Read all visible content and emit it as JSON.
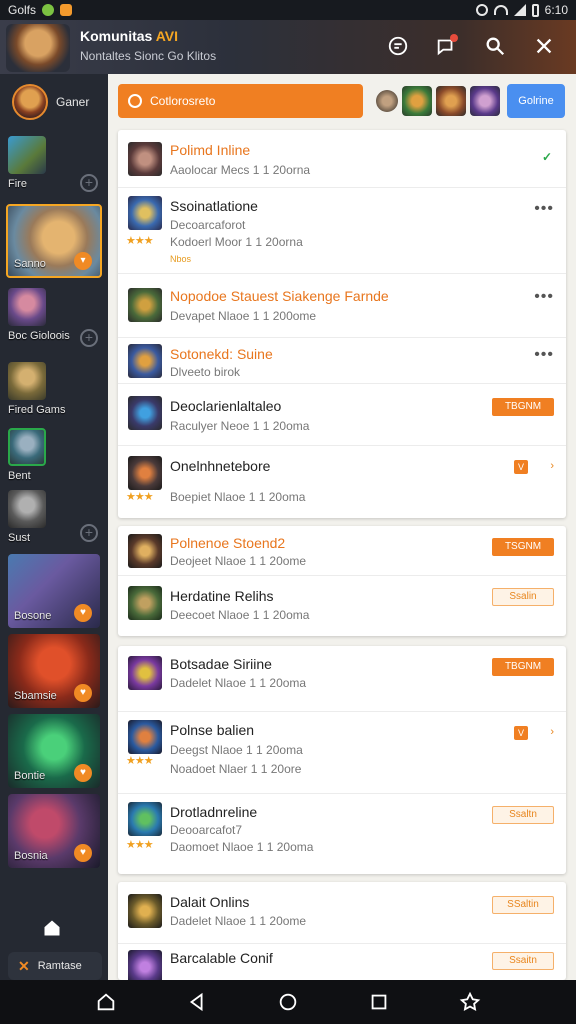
{
  "status": {
    "left_text": "Golfs",
    "time": "6:10"
  },
  "header": {
    "title": "Komunitas",
    "title_accent": "AVI",
    "subtitle": "Nontaltes Sionc Go Klitos"
  },
  "sidebar": {
    "profile_name": "Ganer",
    "items": [
      {
        "label": "Fire"
      },
      {
        "label": "Sanno"
      },
      {
        "label": "Boc Gioloois"
      },
      {
        "label": "Fired Gams"
      },
      {
        "label": "Bent"
      },
      {
        "label": "Sust"
      },
      {
        "label": "Bosone"
      },
      {
        "label": "Sbamsie"
      },
      {
        "label": "Bontie"
      },
      {
        "label": "Bosnia"
      }
    ],
    "footer_label": "Ramtase"
  },
  "topbar": {
    "search_placeholder": "Cotlorosreto",
    "button_label": "Golrine"
  },
  "cards": [
    {
      "rows": [
        {
          "title": "Polimd Inline",
          "sub": "Aaolocar Mecs 1 1 20orna",
          "action": "check"
        },
        {
          "title": "Ssoinatlatione",
          "sub": "Decoarcaforot",
          "meta": "Kodoerl Moor 1 1 20orna",
          "tag": "Nbos",
          "stars": "★★★",
          "action": "more"
        },
        {
          "title": "Nopodoe Stauest Siakenge Farnde",
          "sub": "Devapet Nlaoe 1 1 200ome",
          "action": "more"
        },
        {
          "title": "Sotonekd: Suine",
          "sub": "Dlveeto birok",
          "action": "more"
        },
        {
          "title": "Deoclarienlaltaleo",
          "sub": "Raculyer Neoe 1 1 20oma",
          "action": "fill",
          "action_label": "TBGNM"
        },
        {
          "title": "Onelnhnetebore",
          "meta": "Boepiet Nlaoe 1 1 20oma",
          "stars": "★★★",
          "action": "small",
          "action_label": "V"
        }
      ]
    },
    {
      "rows": [
        {
          "title": "Polnenoe Stoend2",
          "sub": "Deojeet Nlaoe 1 1 20ome",
          "action": "fill",
          "action_label": "TSGNM"
        },
        {
          "title": "Herdatine Relihs",
          "sub": "Deecoet Nlaoe 1 1 20oma",
          "action": "outline",
          "action_label": "Ssalin"
        }
      ]
    },
    {
      "rows": [
        {
          "title": "Botsadae Siriine",
          "sub": "Dadelet Nlaoe 1 1 20oma",
          "action": "fill",
          "action_label": "TBGNM"
        },
        {
          "title": "Polnse balien",
          "sub": "Deegst Nlaoe 1 1 20oma",
          "meta": "Noadoet Nlaer 1 1 20ore",
          "stars": "★★★",
          "action": "small",
          "action_label": "V"
        },
        {
          "title": "Drotladnreline",
          "sub": "Deooarcafot7",
          "meta": "Daomoet Nlaoe 1 1 20oma",
          "stars": "★★★",
          "action": "outline",
          "action_label": "Ssaltn"
        }
      ]
    },
    {
      "rows": [
        {
          "title": "Dalait Onlins",
          "sub": "Dadelet Nlaoe 1 1 20ome",
          "action": "outline",
          "action_label": "SSaltin"
        },
        {
          "title": "Barcalable Conif",
          "action": "outline",
          "action_label": "Ssaitn"
        }
      ]
    }
  ],
  "colors": {
    "accent": "#f07f22",
    "blue": "#4a8ff0",
    "sidebar_bg": "#252932",
    "content_bg": "#f2f1ec"
  },
  "icons": [
    "search-icon",
    "chat-icon",
    "notification-icon",
    "close-icon",
    "home-icon",
    "back-icon",
    "circle-home-icon",
    "square-recents-icon"
  ]
}
